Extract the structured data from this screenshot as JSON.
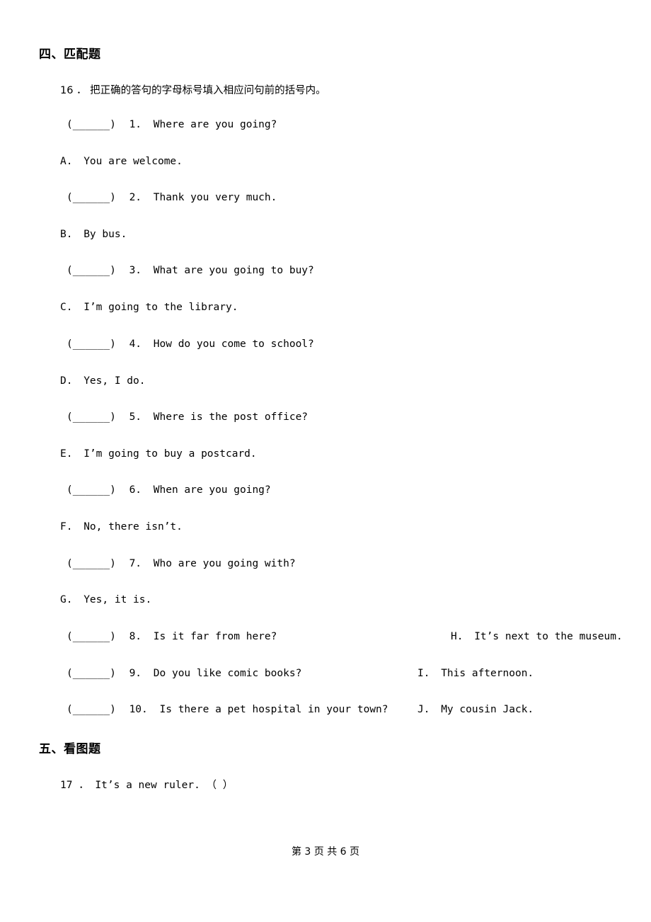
{
  "document": {
    "sections": [
      {
        "title": "四、匹配题"
      },
      {
        "title": "五、看图题"
      }
    ],
    "instruction": "16 ． 把正确的答句的字母标号填入相应问句前的括号内。",
    "matching_items": [
      {
        "blank": "(______)",
        "number": "1.",
        "text": "Where are you going?"
      },
      {
        "blank": "(______)",
        "number": "2.",
        "text": "Thank you very much."
      },
      {
        "blank": "(______)",
        "number": "3.",
        "text": "What are you going to buy?"
      },
      {
        "blank": "(______)",
        "number": "4.",
        "text": "How do you come to school?"
      },
      {
        "blank": "(______)",
        "number": "5.",
        "text": "Where is the post office?"
      },
      {
        "blank": "(______)",
        "number": "6.",
        "text": "When are you going?"
      },
      {
        "blank": "(______)",
        "number": "7.",
        "text": "Who are you going with?"
      },
      {
        "blank": "(______)",
        "number": "8.",
        "text": "Is it far from here?"
      },
      {
        "blank": "(______)",
        "number": "9.",
        "text": "Do you like comic books?"
      },
      {
        "blank": "(______)",
        "number": "10.",
        "text": "Is there a pet hospital in your town?"
      }
    ],
    "answer_options_left": [
      {
        "label": "A.",
        "text": "You are welcome."
      },
      {
        "label": "B.",
        "text": "By bus."
      },
      {
        "label": "C.",
        "text": "I’m going to the library."
      },
      {
        "label": "D.",
        "text": "Yes, I do."
      },
      {
        "label": "E.",
        "text": "I’m going to buy a postcard."
      },
      {
        "label": "F.",
        "text": "No, there isn’t."
      },
      {
        "label": "G.",
        "text": "Yes, it is."
      }
    ],
    "answer_options_right": [
      {
        "label": "H.",
        "text": "It’s next to the museum."
      },
      {
        "label": "I.",
        "text": "This afternoon."
      },
      {
        "label": "J.",
        "text": "My cousin Jack."
      }
    ],
    "picture_question": "17 ． It’s a new ruler.  （    ）",
    "footer": "第 3 页 共 6 页"
  }
}
